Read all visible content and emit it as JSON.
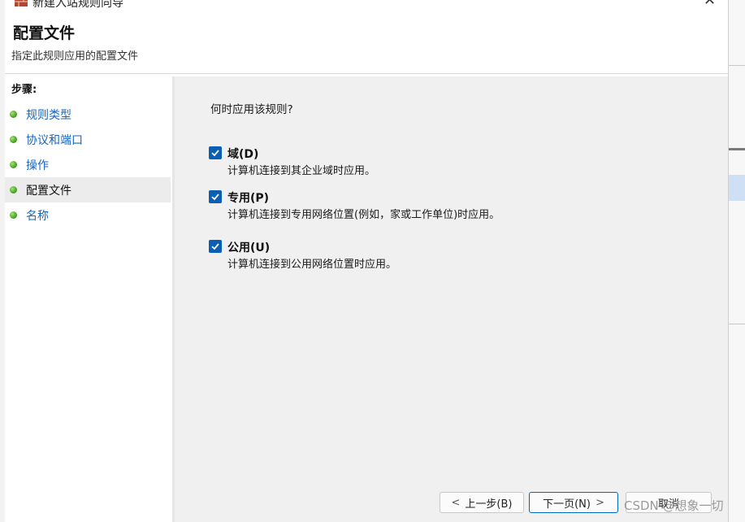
{
  "window": {
    "title": "新建入站规则向导",
    "close_glyph": "✕"
  },
  "header": {
    "title": "配置文件",
    "subtitle": "指定此规则应用的配置文件"
  },
  "steps": {
    "title": "步骤:",
    "items": [
      {
        "label": "规则类型",
        "active": false
      },
      {
        "label": "协议和端口",
        "active": false
      },
      {
        "label": "操作",
        "active": false
      },
      {
        "label": "配置文件",
        "active": true
      },
      {
        "label": "名称",
        "active": false
      }
    ]
  },
  "main": {
    "question": "何时应用该规则?",
    "options": [
      {
        "label": "域(D)",
        "description": "计算机连接到其企业域时应用。",
        "checked": true
      },
      {
        "label": "专用(P)",
        "description": "计算机连接到专用网络位置(例如，家或工作单位)时应用。",
        "checked": true
      },
      {
        "label": "公用(U)",
        "description": "计算机连接到公用网络位置时应用。",
        "checked": true
      }
    ]
  },
  "buttons": {
    "back": "上一步(B)",
    "next": "下一页(N)",
    "cancel": "取消",
    "back_chevron": "<",
    "next_chevron": ">"
  },
  "watermark": "CSDN @想象一切",
  "colors": {
    "accent": "#0a5fb4",
    "link": "#1565c0",
    "step_dot": "#3a9a20"
  },
  "icons": [
    "firewall-brick-icon",
    "close-icon",
    "step-dot-icon",
    "checkbox-check-icon",
    "chevron-left-icon",
    "chevron-right-icon"
  ]
}
